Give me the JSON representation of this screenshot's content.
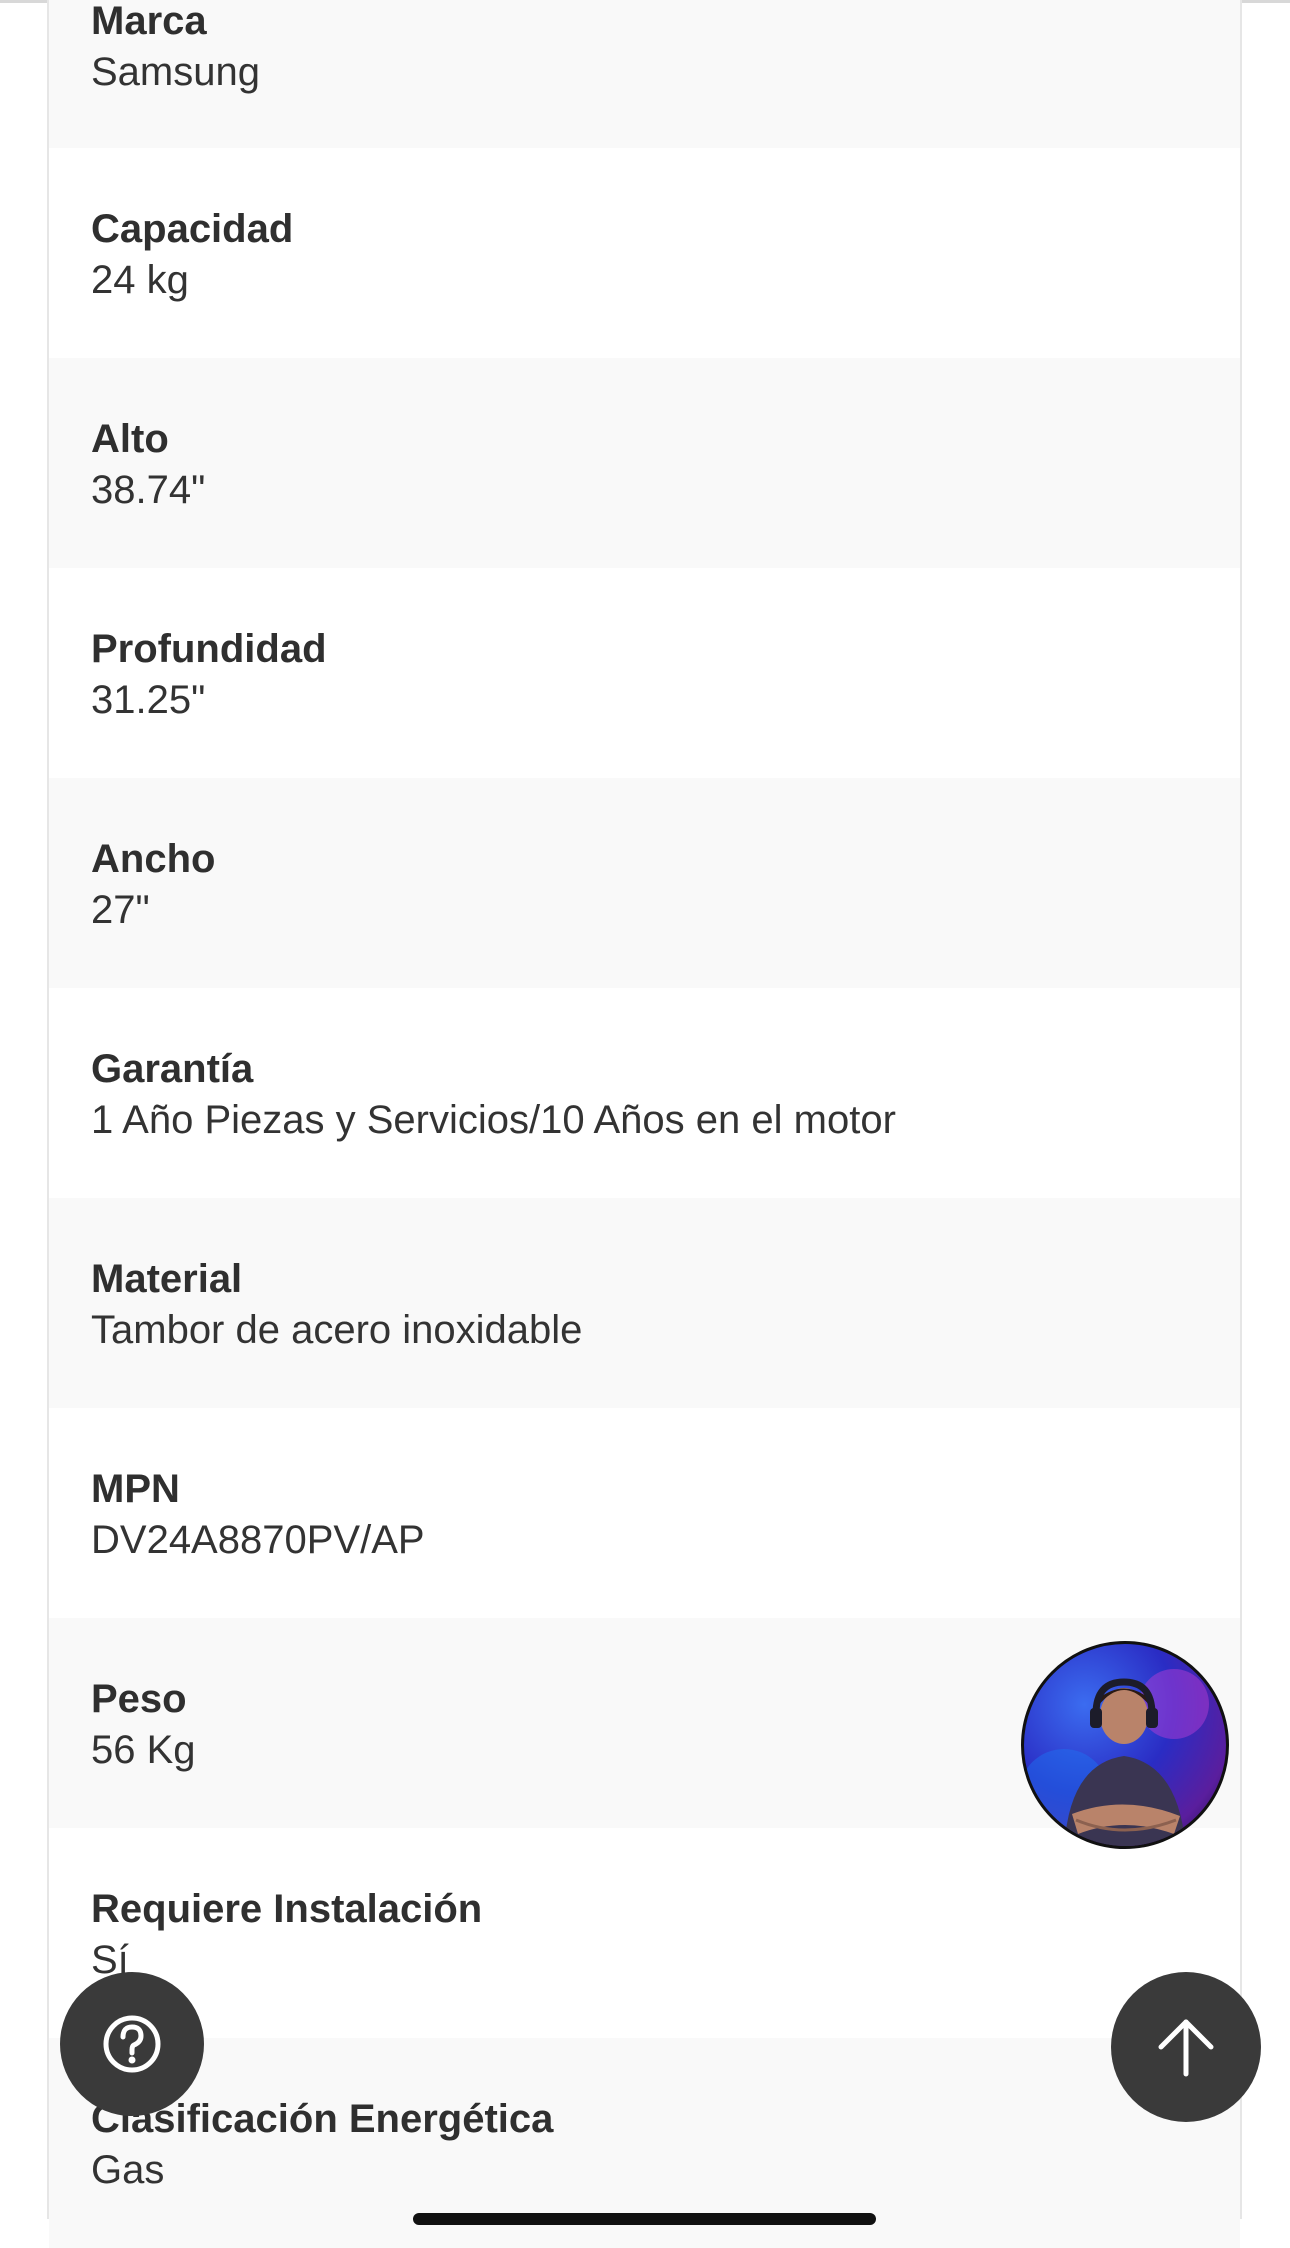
{
  "specs": [
    {
      "label": "Marca",
      "value": "Samsung"
    },
    {
      "label": "Capacidad",
      "value": "24 kg"
    },
    {
      "label": "Alto",
      "value": "38.74\""
    },
    {
      "label": "Profundidad",
      "value": "31.25\""
    },
    {
      "label": "Ancho",
      "value": "27\""
    },
    {
      "label": "Garantía",
      "value": "1 Año Piezas y Servicios/10 Años en el motor"
    },
    {
      "label": "Material",
      "value": "Tambor de acero inoxidable"
    },
    {
      "label": "MPN",
      "value": "DV24A8870PV/AP"
    },
    {
      "label": "Peso",
      "value": "56 Kg"
    },
    {
      "label": "Requiere Instalación",
      "value": "Sí"
    },
    {
      "label": "Clasificación Energética",
      "value": "Gas"
    }
  ],
  "icons": {
    "help": "question-circle-icon",
    "scroll_top": "arrow-up-icon",
    "avatar": "chat-agent-avatar"
  },
  "colors": {
    "fab_background": "#3a3a3a",
    "row_shade": "#f9f9f9",
    "label_text": "#2f2f2f"
  }
}
